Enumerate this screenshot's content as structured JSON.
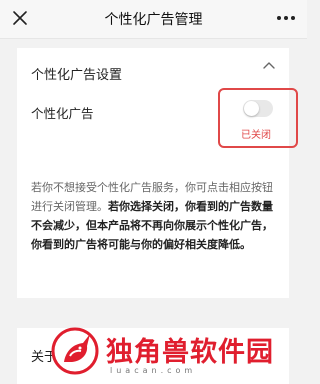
{
  "header": {
    "title": "个性化广告管理",
    "close_icon": "close-icon",
    "more_icon": "more-icon"
  },
  "settings_card": {
    "section_title": "个性化广告设置",
    "collapse_icon": "chevron-up-icon",
    "toggle_label": "个性化广告",
    "toggle_on": false,
    "status_text": "已关闭",
    "highlight_color": "#e04848",
    "description_plain": "若你不想接受个性化广告服务，你可点击相应按钮进行关闭管理。",
    "description_bold": "若你选择关闭，你看到的广告数量不会减少，但本产品将不再向你展示个性化广告，你看到的广告将可能与你的偏好相关度降低。"
  },
  "about_card": {
    "title": "关于"
  },
  "watermark": {
    "brand": "独角兽软件园",
    "sub": "luacan.com",
    "color": "#e01e2e"
  }
}
